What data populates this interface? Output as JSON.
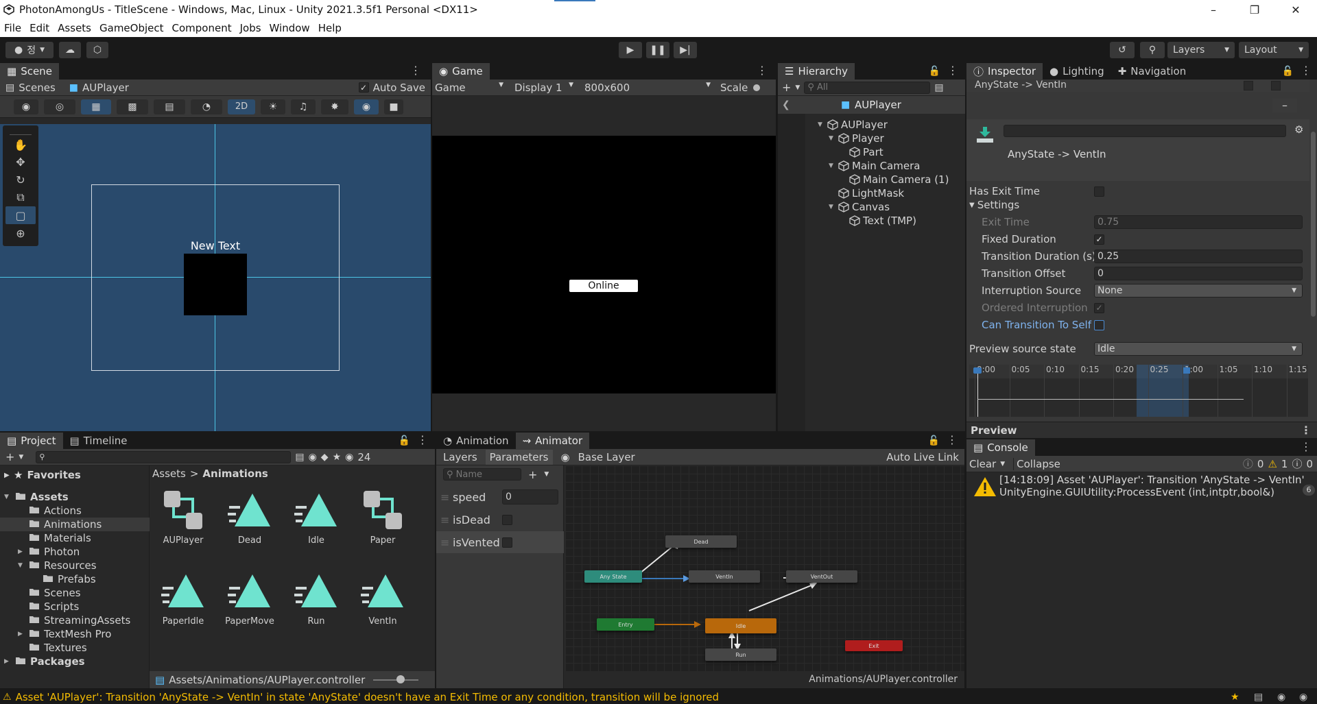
{
  "window": {
    "title": "PhotonAmongUs - TitleScene - Windows, Mac, Linux - Unity 2021.3.5f1 Personal <DX11>"
  },
  "menu": [
    "File",
    "Edit",
    "Assets",
    "GameObject",
    "Component",
    "Jobs",
    "Window",
    "Help"
  ],
  "toolbar": {
    "account_label": "정",
    "layers_label": "Layers",
    "layout_label": "Layout"
  },
  "scene": {
    "tab": "Scene",
    "breadcrumb_root": "Scenes",
    "breadcrumb_object": "AUPlayer",
    "auto_save": "Auto Save",
    "mode_2d": "2D",
    "canvas_text": "New Text"
  },
  "game": {
    "tab": "Game",
    "view": "Game",
    "display": "Display 1",
    "resolution": "800x600",
    "scale": "Scale",
    "button": "Online"
  },
  "hierarchy": {
    "tab": "Hierarchy",
    "search": "All",
    "prefab": "AUPlayer",
    "items": [
      {
        "label": "AUPlayer",
        "depth": 0,
        "arrow": true
      },
      {
        "label": "Player",
        "depth": 1,
        "arrow": true
      },
      {
        "label": "Part",
        "depth": 2,
        "arrow": false
      },
      {
        "label": "Main Camera",
        "depth": 1,
        "arrow": true
      },
      {
        "label": "Main Camera (1)",
        "depth": 2,
        "arrow": false
      },
      {
        "label": "LightMask",
        "depth": 1,
        "arrow": false
      },
      {
        "label": "Canvas",
        "depth": 1,
        "arrow": true
      },
      {
        "label": "Text (TMP)",
        "depth": 2,
        "arrow": false
      }
    ]
  },
  "inspector": {
    "tabs": [
      "Inspector",
      "Lighting",
      "Navigation"
    ],
    "header": "AnyState -> VentIn",
    "transition_name": "AnyState -> VentIn",
    "has_exit_time": "Has Exit Time",
    "settings": "Settings",
    "exit_time_label": "Exit Time",
    "exit_time": "0.75",
    "fixed_duration_label": "Fixed Duration",
    "transition_duration_label": "Transition Duration (s)",
    "transition_duration": "0.25",
    "transition_offset_label": "Transition Offset",
    "transition_offset": "0",
    "interruption_source_label": "Interruption Source",
    "interruption_source": "None",
    "ordered_interruption_label": "Ordered Interruption",
    "can_transition_label": "Can Transition To Self",
    "preview_source_label": "Preview source state",
    "preview_source": "Idle",
    "timeline_ticks": [
      "0:00",
      "0:05",
      "0:10",
      "0:15",
      "0:20",
      "0:25",
      "1:00",
      "1:05",
      "1:10",
      "1:15"
    ],
    "preview": "Preview"
  },
  "project": {
    "tabs": [
      "Project",
      "Timeline"
    ],
    "hidden_count": "24",
    "favorites": "Favorites",
    "tree": [
      {
        "label": "Assets",
        "depth": 0,
        "bold": true,
        "arrow": "down"
      },
      {
        "label": "Actions",
        "depth": 1,
        "arrow": ""
      },
      {
        "label": "Animations",
        "depth": 1,
        "arrow": "",
        "selected": true
      },
      {
        "label": "Materials",
        "depth": 1,
        "arrow": ""
      },
      {
        "label": "Photon",
        "depth": 1,
        "arrow": "right"
      },
      {
        "label": "Resources",
        "depth": 1,
        "arrow": "down"
      },
      {
        "label": "Prefabs",
        "depth": 2,
        "arrow": ""
      },
      {
        "label": "Scenes",
        "depth": 1,
        "arrow": ""
      },
      {
        "label": "Scripts",
        "depth": 1,
        "arrow": ""
      },
      {
        "label": "StreamingAssets",
        "depth": 1,
        "arrow": ""
      },
      {
        "label": "TextMesh Pro",
        "depth": 1,
        "arrow": "right"
      },
      {
        "label": "Textures",
        "depth": 1,
        "arrow": ""
      },
      {
        "label": "Packages",
        "depth": 0,
        "bold": true,
        "arrow": "right"
      }
    ],
    "path_root": "Assets",
    "path_leaf": "Animations",
    "assets": [
      {
        "label": "AUPlayer",
        "kind": "controller"
      },
      {
        "label": "Dead",
        "kind": "clip"
      },
      {
        "label": "Idle",
        "kind": "clip"
      },
      {
        "label": "Paper",
        "kind": "controller"
      },
      {
        "label": "PaperIdle",
        "kind": "clip"
      },
      {
        "label": "PaperMove",
        "kind": "clip"
      },
      {
        "label": "Run",
        "kind": "clip"
      },
      {
        "label": "VentIn",
        "kind": "clip"
      }
    ],
    "footer_path": "Assets/Animations/AUPlayer.controller"
  },
  "animator": {
    "tabs": [
      "Animation",
      "Animator"
    ],
    "layers": "Layers",
    "parameters": "Parameters",
    "base_layer": "Base Layer",
    "auto_live_link": "Auto Live Link",
    "name_placeholder": "Name",
    "params": [
      {
        "name": "speed",
        "type": "float",
        "value": "0"
      },
      {
        "name": "isDead",
        "type": "bool"
      },
      {
        "name": "isVented",
        "type": "bool"
      }
    ],
    "nodes": {
      "dead": "Dead",
      "any_state": "Any State",
      "ventin": "VentIn",
      "ventout": "VentOut",
      "entry": "Entry",
      "idle": "Idle",
      "run": "Run",
      "exit": "Exit"
    },
    "footer": "Animations/AUPlayer.controller"
  },
  "console": {
    "tab": "Console",
    "clear": "Clear",
    "collapse": "Collapse",
    "count_info": "0",
    "count_warn": "1",
    "count_error": "0",
    "msg_line1": "[14:18:09] Asset 'AUPlayer': Transition 'AnyState -> VentIn' in sta",
    "msg_line2": "UnityEngine.GUIUtility:ProcessEvent (int,intptr,bool&)",
    "msg_count": "6"
  },
  "status": {
    "message": "Asset 'AUPlayer': Transition 'AnyState -> VentIn' in state 'AnyState' doesn't have an Exit Time or any condition, transition will be ignored"
  },
  "colors": {
    "accent": "#3a79bb",
    "warning": "#f4bc02",
    "scene_bg": "#294a6c",
    "entry": "#1f7a32",
    "any_state": "#2e8c7c",
    "default_state": "#b8680b",
    "exit": "#b01d1d"
  }
}
